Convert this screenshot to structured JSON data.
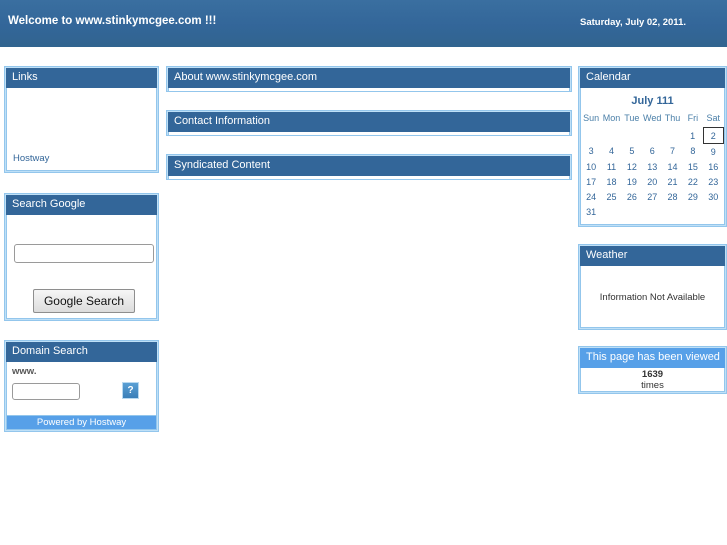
{
  "banner": {
    "title": "Welcome to www.stinkymcgee.com !!!",
    "date": "Saturday, July 02, 2011."
  },
  "sidebar": {
    "links_panel": {
      "title": "Links",
      "links": [
        {
          "label": "Hostway"
        }
      ]
    },
    "google_panel": {
      "title": "Search Google",
      "query_value": "",
      "query_placeholder": "",
      "button_label": "Google Search"
    },
    "domain_panel": {
      "title": "Domain Search",
      "www_label": "www.",
      "domain_value": "",
      "domain_placeholder": "",
      "go_icon": "broken-image-icon",
      "go_glyph": "?",
      "footer_label": "Powered by Hostway"
    }
  },
  "main": {
    "panels": [
      {
        "title": "About www.stinkymcgee.com"
      },
      {
        "title": "Contact Information"
      },
      {
        "title": "Syndicated Content"
      }
    ]
  },
  "right": {
    "calendar": {
      "title": "Calendar",
      "month_label": "July 111",
      "weekdays": [
        "Sun",
        "Mon",
        "Tue",
        "Wed",
        "Thu",
        "Fri",
        "Sat"
      ],
      "weeks": [
        [
          "",
          "",
          "",
          "",
          "",
          "1",
          "2"
        ],
        [
          "3",
          "4",
          "5",
          "6",
          "7",
          "8",
          "9"
        ],
        [
          "10",
          "11",
          "12",
          "13",
          "14",
          "15",
          "16"
        ],
        [
          "17",
          "18",
          "19",
          "20",
          "21",
          "22",
          "23"
        ],
        [
          "24",
          "25",
          "26",
          "27",
          "28",
          "29",
          "30"
        ],
        [
          "31",
          "",
          "",
          "",
          "",
          "",
          ""
        ]
      ],
      "today": "2"
    },
    "weather": {
      "title": "Weather",
      "message": "Information Not Available"
    },
    "views": {
      "title": "This page has been viewed",
      "count": "1639",
      "label": "times"
    }
  },
  "colors": {
    "banner_blue": "#336699",
    "header_blue": "#336699",
    "light_blue": "#57a0e8",
    "panel_border": "#93c6ec",
    "panel_fill": "#bfe0f7",
    "link_blue": "#336699"
  }
}
